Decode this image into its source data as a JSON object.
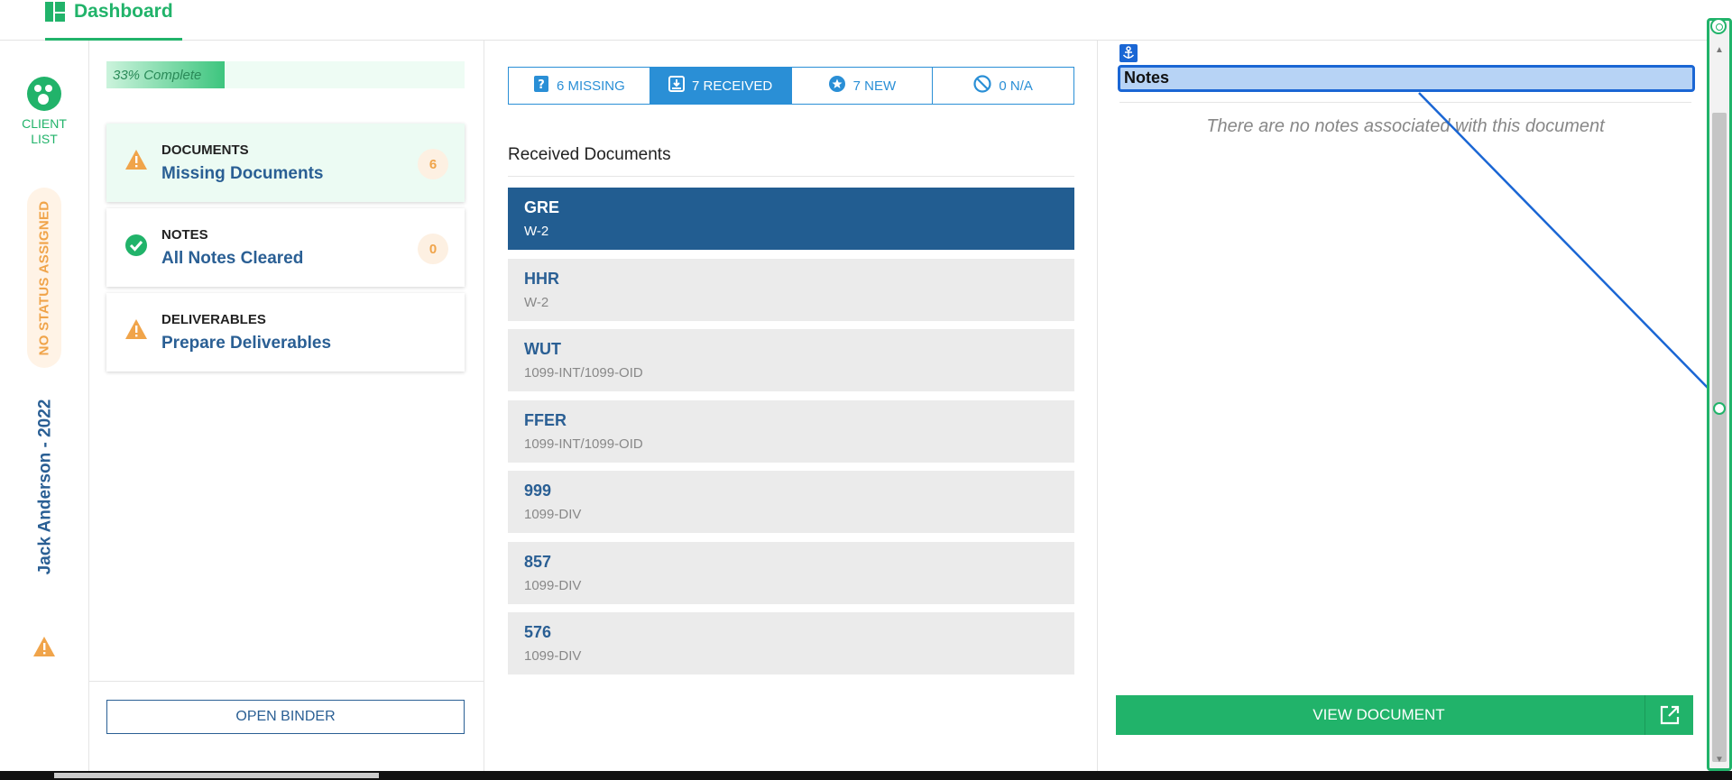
{
  "header": {
    "tab_label": "Dashboard",
    "tab_icon": "dashboard-grid-icon"
  },
  "rail": {
    "client_list_label": "CLIENT LIST",
    "status_label": "NO STATUS ASSIGNED",
    "client_name": "Jack Anderson - 2022",
    "warning_icon": "warning-triangle-icon"
  },
  "progress": {
    "label": "33% Complete",
    "fraction": 0.33
  },
  "cards": [
    {
      "title": "DOCUMENTS",
      "subtitle": "Missing Documents",
      "count": "6",
      "icon": "warning-icon",
      "active": true
    },
    {
      "title": "NOTES",
      "subtitle": "All Notes Cleared",
      "count": "0",
      "icon": "check-circle-icon",
      "active": false
    },
    {
      "title": "DELIVERABLES",
      "subtitle": "Prepare Deliverables",
      "count": "",
      "icon": "warning-icon",
      "active": false
    }
  ],
  "open_binder_label": "OPEN BINDER",
  "tabs": [
    {
      "label": "6 MISSING",
      "icon": "question-icon",
      "selected": false
    },
    {
      "label": "7 RECEIVED",
      "icon": "inbox-icon",
      "selected": true
    },
    {
      "label": "7 NEW",
      "icon": "star-icon",
      "selected": false
    },
    {
      "label": "0 N/A",
      "icon": "ban-icon",
      "selected": false
    }
  ],
  "received": {
    "title": "Received Documents",
    "documents": [
      {
        "name": "GRE",
        "type": "W-2",
        "selected": true
      },
      {
        "name": "HHR",
        "type": "W-2",
        "selected": false
      },
      {
        "name": "WUT",
        "type": "1099-INT/1099-OID",
        "selected": false
      },
      {
        "name": "FFER",
        "type": "1099-INT/1099-OID",
        "selected": false
      },
      {
        "name": "999",
        "type": "1099-DIV",
        "selected": false
      },
      {
        "name": "857",
        "type": "1099-DIV",
        "selected": false
      },
      {
        "name": "576",
        "type": "1099-DIV",
        "selected": false
      }
    ]
  },
  "notes": {
    "header": "Notes",
    "empty_message": "There are no notes associated with this document"
  },
  "view_document_label": "VIEW DOCUMENT",
  "colors": {
    "green": "#21b36a",
    "navy": "#225d91",
    "blue": "#2a8fd6",
    "orange": "#f0a44a"
  }
}
